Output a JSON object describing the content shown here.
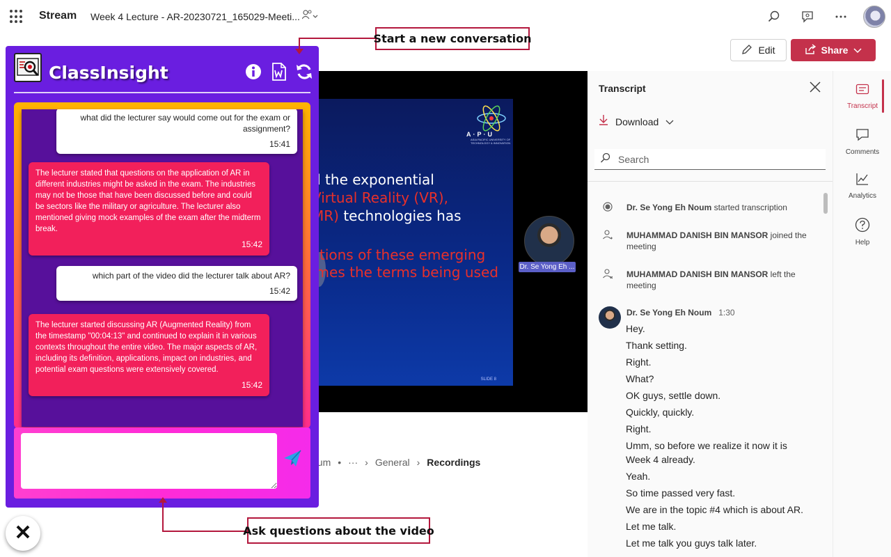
{
  "topbar": {
    "app_name": "Stream",
    "doc_title": "Week 4 Lecture - AR-20230721_165029-Meeti...",
    "people_icon": "people-chevron-icon"
  },
  "actions": {
    "edit_label": "Edit",
    "share_label": "Share"
  },
  "video": {
    "logo_text": "A·P·U",
    "logo_subtext": "ASIA PACIFIC UNIVERSITY OF TECHNOLOGY & INNOVATION",
    "slide_lines": [
      {
        "text": "d the exponential",
        "color": "white"
      },
      {
        "text": " Virtual Reality (VR),",
        "color": "red"
      },
      {
        "text": "MR) technologies has",
        "color": "mixed"
      },
      {
        "text": "ctions of these emerging",
        "color": "red"
      },
      {
        "text": "imes the terms being used",
        "color": "red"
      }
    ],
    "slide_line_3_red": "MR)",
    "slide_line_3_white": " technologies has",
    "slide_number": "SLIDE 8",
    "presenter_label": "Dr. Se Yong Eh ..."
  },
  "breadcrumb": {
    "owner_fragment": "oum",
    "ellipsis": "···",
    "items": [
      "General",
      "Recordings"
    ]
  },
  "transcript": {
    "title": "Transcript",
    "download_label": "Download",
    "search_placeholder": "Search",
    "events": [
      {
        "name": "Dr. Se Yong Eh Noum",
        "action": "started transcription"
      },
      {
        "name": "MUHAMMAD DANISH BIN MANSOR",
        "action": "joined the meeting"
      },
      {
        "name": "MUHAMMAD DANISH BIN MANSOR",
        "action": "left the meeting"
      }
    ],
    "speaker": {
      "name": "Dr. Se Yong Eh Noum",
      "timestamp": "1:30"
    },
    "lines": [
      "Hey.",
      "Thank setting.",
      "Right.",
      "What?",
      "OK guys, settle down.",
      "Quickly, quickly.",
      "Right.",
      "Umm, so before we realize it now it is Week 4 already.",
      "Yeah.",
      "So time passed very fast.",
      "We are in the topic #4 which is about AR.",
      "Let me talk.",
      "Let me talk you guys talk later."
    ]
  },
  "rail": {
    "items": [
      {
        "label": "Transcript",
        "icon": "transcript-icon",
        "active": true
      },
      {
        "label": "Comments",
        "icon": "comment-icon",
        "active": false
      },
      {
        "label": "Analytics",
        "icon": "analytics-icon",
        "active": false
      },
      {
        "label": "Help",
        "icon": "help-icon",
        "active": false
      }
    ]
  },
  "classinsight": {
    "title": "ClassInsight",
    "header_icons": [
      "info-icon",
      "word-document-icon",
      "refresh-icon"
    ],
    "messages": [
      {
        "role": "user",
        "text": "what did the lecturer say would come out for the exam or assignment?",
        "time": "15:41"
      },
      {
        "role": "bot",
        "text": "The lecturer stated that questions on the application of AR in different industries might be asked in the exam. The industries may not be those that have been discussed before and could be sectors like the military or agriculture. The lecturer also mentioned giving mock examples of the exam after the midterm break.",
        "time": "15:42"
      },
      {
        "role": "user",
        "text": "which part of the video did the lecturer talk about AR?",
        "time": "15:42"
      },
      {
        "role": "bot",
        "text": "The lecturer started discussing AR (Augmented Reality) from the timestamp \"00:04:13\" and continued to explain it in various contexts throughout the entire video. The major aspects of AR, including its definition, applications, impact on industries, and potential exam questions were extensively covered.",
        "time": "15:42"
      }
    ],
    "input_placeholder": "",
    "colors": {
      "panel": "#6a1ee0",
      "chat_bg": "#57109b",
      "bot_bubble": "#f2205b",
      "input_frame": "#ff2bd7"
    }
  },
  "callouts": {
    "top": "Start a new conversation",
    "bottom": "Ask questions about the video"
  },
  "colors": {
    "brand": "#c4314b"
  }
}
